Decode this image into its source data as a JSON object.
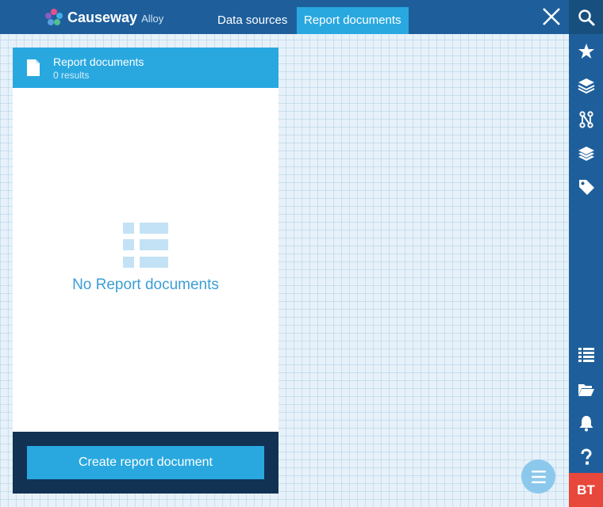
{
  "header": {
    "brand_name": "Causeway",
    "brand_sub": "Alloy",
    "tabs": [
      {
        "label": "Data sources",
        "active": false
      },
      {
        "label": "Report documents",
        "active": true
      }
    ],
    "close_icon": "close-icon"
  },
  "rail": {
    "top_icons": [
      "search-icon",
      "star-icon",
      "layers-icon",
      "graph-icon",
      "layers-icon",
      "tag-icon"
    ],
    "bottom_icons": [
      "list-icon",
      "folder-icon",
      "bell-icon",
      "help-icon"
    ],
    "avatar_initials": "BT"
  },
  "panel": {
    "title": "Report documents",
    "result_count": "0 results",
    "empty_message": "No Report documents",
    "create_button": "Create report document"
  },
  "colors": {
    "nav_bg": "#1e5f9b",
    "accent": "#29a8e0",
    "footer_bg": "#123254",
    "avatar_bg": "#e8473b",
    "empty_icon": "#c3e2f5"
  }
}
